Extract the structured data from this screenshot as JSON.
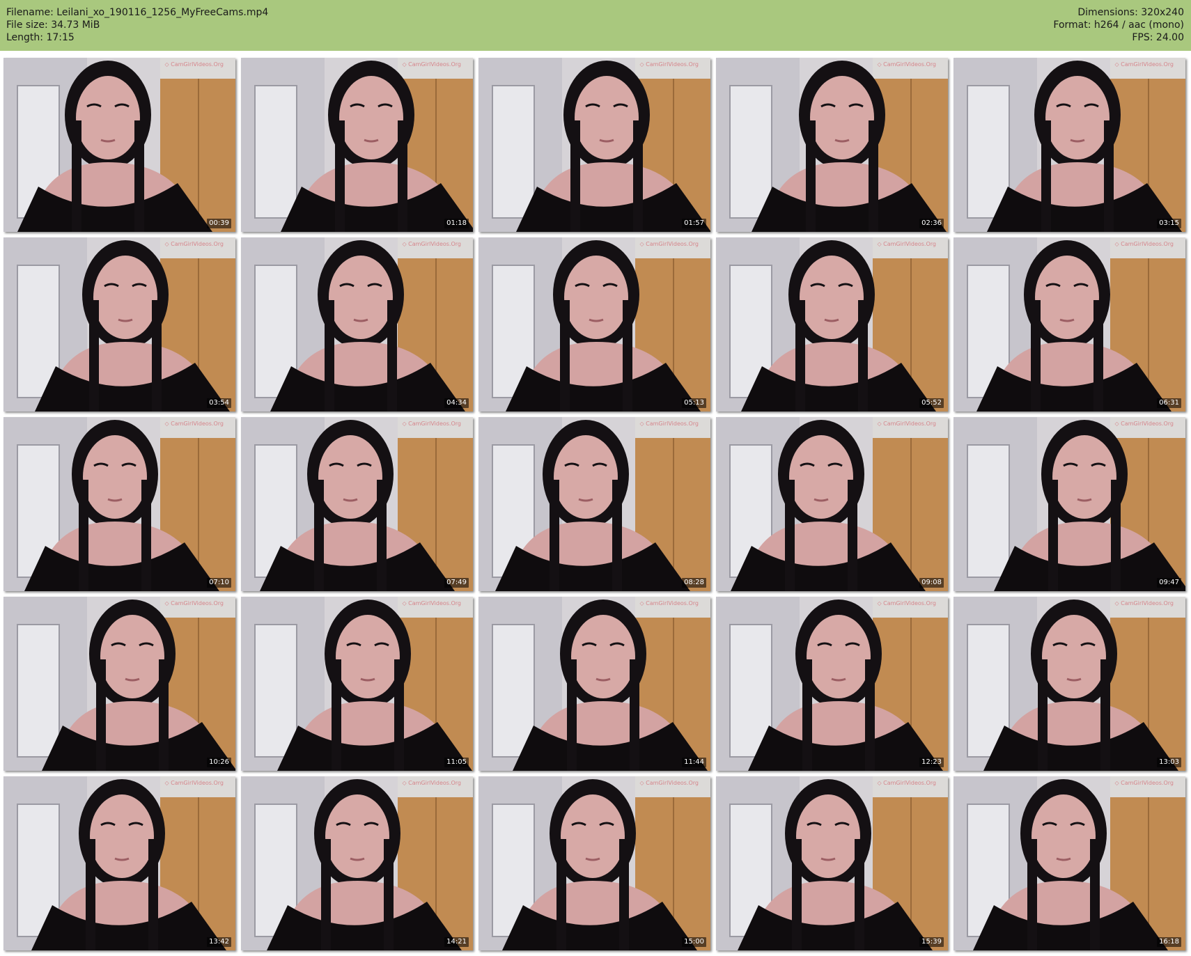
{
  "header": {
    "filename": "Filename: Leilani_xo_190116_1256_MyFreeCams.mp4",
    "file_size": "File size: 34.73 MiB",
    "length": "Length: 17:15",
    "dimensions": "Dimensions: 320x240",
    "format": "Format: h264 / aac (mono)",
    "fps": "FPS: 24.00"
  },
  "colors": {
    "header_bg": "#a9c87e",
    "wall": "#d9d6d8",
    "door": "#c98f4f",
    "skin": "#d8a9a7",
    "hair": "#141013",
    "shirt": "#0f0c0e"
  },
  "thumbnails": [
    {
      "timestamp": "00:39"
    },
    {
      "timestamp": "01:18"
    },
    {
      "timestamp": "01:57"
    },
    {
      "timestamp": "02:36"
    },
    {
      "timestamp": "03:15"
    },
    {
      "timestamp": "03:54"
    },
    {
      "timestamp": "04:34"
    },
    {
      "timestamp": "05:13"
    },
    {
      "timestamp": "05:52"
    },
    {
      "timestamp": "06:31"
    },
    {
      "timestamp": "07:10"
    },
    {
      "timestamp": "07:49"
    },
    {
      "timestamp": "08:28"
    },
    {
      "timestamp": "09:08"
    },
    {
      "timestamp": "09:47"
    },
    {
      "timestamp": "10:26"
    },
    {
      "timestamp": "11:05"
    },
    {
      "timestamp": "11:44"
    },
    {
      "timestamp": "12:23"
    },
    {
      "timestamp": "13:03"
    },
    {
      "timestamp": "13:42"
    },
    {
      "timestamp": "14:21"
    },
    {
      "timestamp": "15:00"
    },
    {
      "timestamp": "15:39"
    },
    {
      "timestamp": "16:18"
    }
  ]
}
